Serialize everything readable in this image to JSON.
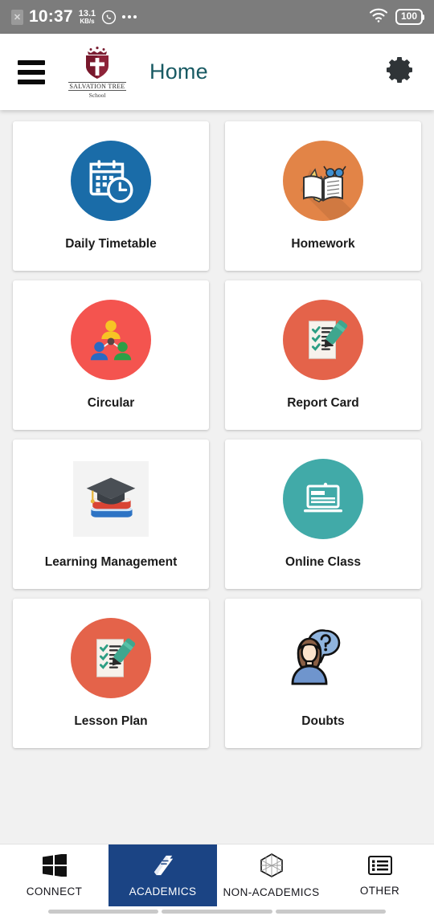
{
  "status_bar": {
    "sim_icon": "sim-card-icon",
    "time": "10:37",
    "net_speed_value": "13.1",
    "net_speed_unit": "KB/s",
    "whatsapp_icon": "whatsapp-icon",
    "more_icon": "more-dots-icon",
    "wifi_icon": "wifi-icon",
    "battery_level": "100",
    "background": "#7c7c7c"
  },
  "app_bar": {
    "menu_icon": "hamburger-menu-icon",
    "logo": {
      "icon": "school-shield-logo",
      "name": "SALVATION TREE",
      "subtitle": "School",
      "shield_color": "#8e2339"
    },
    "title": "Home",
    "title_color": "#185a63",
    "settings_icon": "gear-icon"
  },
  "grid": {
    "cards": [
      {
        "label": "Daily Timetable",
        "icon": "calendar-clock-icon",
        "bg": "#1a6ca8",
        "shape": "circle"
      },
      {
        "label": "Homework",
        "icon": "notebook-pencil-glasses-icon",
        "bg": "#e28447",
        "shape": "circle"
      },
      {
        "label": "Circular",
        "icon": "people-network-icon",
        "bg": "#f4544f",
        "shape": "circle"
      },
      {
        "label": "Report Card",
        "icon": "checklist-pen-icon",
        "bg": "#e4634a",
        "shape": "circle"
      },
      {
        "label": "Learning Management",
        "icon": "graduation-cap-books-icon",
        "bg": "#f3f3f3",
        "shape": "square"
      },
      {
        "label": "Online Class",
        "icon": "laptop-screen-icon",
        "bg": "#41aaa8",
        "shape": "circle"
      },
      {
        "label": "Lesson Plan",
        "icon": "checklist-pen-icon",
        "bg": "#e4634a",
        "shape": "circle"
      },
      {
        "label": "Doubts",
        "icon": "person-question-icon",
        "bg": "#ffffff",
        "shape": "plain"
      }
    ]
  },
  "bottom_nav": {
    "active_index": 1,
    "active_color": "#1b4484",
    "items": [
      {
        "label": "CONNECT",
        "icon": "windows-grid-icon"
      },
      {
        "label": "ACADEMICS",
        "icon": "book-icon"
      },
      {
        "label": "NON-ACADEMICS",
        "icon": "hexagon-icon"
      },
      {
        "label": "OTHER",
        "icon": "list-icon"
      }
    ]
  }
}
